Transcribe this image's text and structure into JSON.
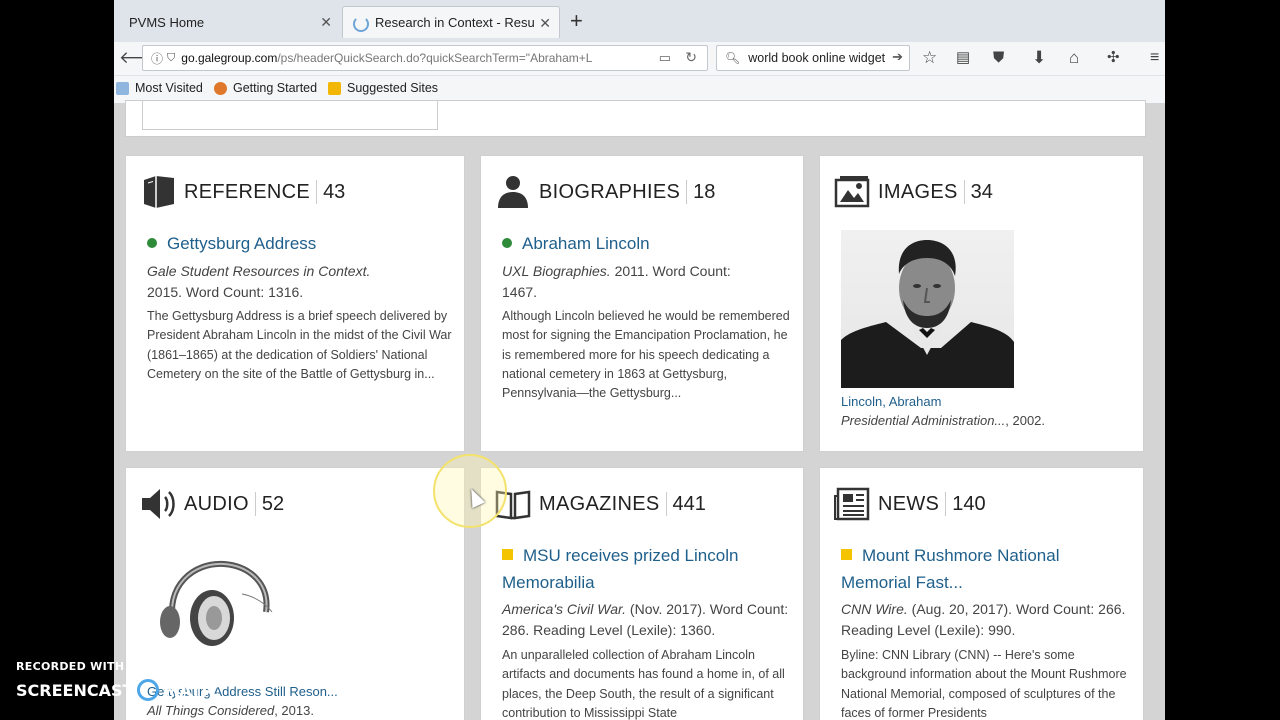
{
  "browser": {
    "tabs": [
      {
        "title": "PVMS Home"
      },
      {
        "title": "Research in Context - Results"
      }
    ],
    "url_host": "go.galegroup.com",
    "url_path": "/ps/headerQuickSearch.do?quickSearchTerm=\"Abraham+L",
    "search_text": "world book online widget",
    "bookmarks": [
      "Most Visited",
      "Getting Started",
      "Suggested Sites"
    ]
  },
  "cards": {
    "reference": {
      "name": "REFERENCE",
      "count": "43",
      "item_title": "Gettysburg Address",
      "source": "Gale Student Resources in Context.",
      "meta_rest": "2015.  Word Count: 1316.",
      "snippet": "The Gettysburg Address is a brief speech delivered by President Abraham Lincoln in the midst of the Civil War (1861–1865) at the dedication of Soldiers' National Cemetery on the site of the Battle of Gettysburg in..."
    },
    "biographies": {
      "name": "BIOGRAPHIES",
      "count": "18",
      "item_title": "Abraham Lincoln",
      "source": "UXL Biographies.",
      "meta_rest": " 2011.  Word Count: 1467.",
      "snippet": "Although Lincoln believed he would be remembered most for signing the Emancipation Proclamation, he is remembered more for his speech dedicating a national cemetery in 1863 at Gettysburg, Pennsylvania—the Gettysburg..."
    },
    "images": {
      "name": "IMAGES",
      "count": "34",
      "caption_link": "Lincoln, Abraham",
      "caption_source": "Presidential Administration...",
      "caption_year": ", 2002."
    },
    "audio": {
      "name": "AUDIO",
      "count": "52",
      "item_title": "Gettysburg Address Still Reson...",
      "source": "All Things Considered",
      "meta_rest": ", 2013."
    },
    "magazines": {
      "name": "MAGAZINES",
      "count": "441",
      "item_title": "MSU receives prized Lincoln Memorabilia",
      "source": "America's Civil War.",
      "meta_rest": " (Nov. 2017).  Word Count: 286.  Reading Level (Lexile): 1360.",
      "snippet": "An unparalleled collection of Abraham Lincoln artifacts and documents has found a home in, of all places, the Deep South, the result of a significant contribution to Mississippi State"
    },
    "news": {
      "name": "NEWS",
      "count": "140",
      "item_title": "Mount Rushmore National Memorial Fast...",
      "source": "CNN Wire.",
      "meta_rest": " (Aug. 20, 2017).  Word Count: 266.  Reading Level (Lexile): 990.",
      "snippet": "Byline: CNN Library (CNN) -- Here's some background information about the Mount Rushmore National Memorial, composed of sculptures of the faces of former Presidents"
    }
  },
  "watermark": {
    "line1": "RECORDED WITH",
    "line2a": "SCREENCAST",
    "line2b": "MATIC"
  }
}
